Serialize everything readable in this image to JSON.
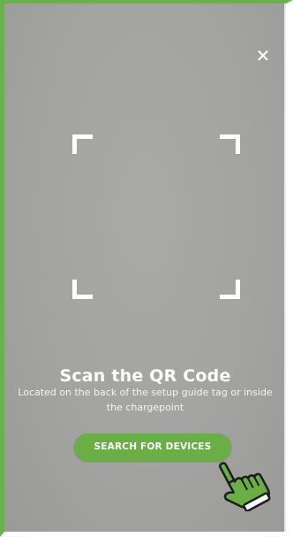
{
  "close": {
    "icon": "close-icon",
    "glyph": "✕"
  },
  "scan": {
    "title": "Scan the QR Code",
    "subtitle": "Located on the back of the setup guide tag or inside the chargepoint"
  },
  "search_button": {
    "label": "SEARCH FOR DEVICES"
  },
  "pointer": {
    "icon": "pointing-hand-icon"
  },
  "colors": {
    "accent": "#6aaf46",
    "frame_border": "#6ab04c",
    "camera_background": "#a3a3a1",
    "text": "#ffffff"
  }
}
